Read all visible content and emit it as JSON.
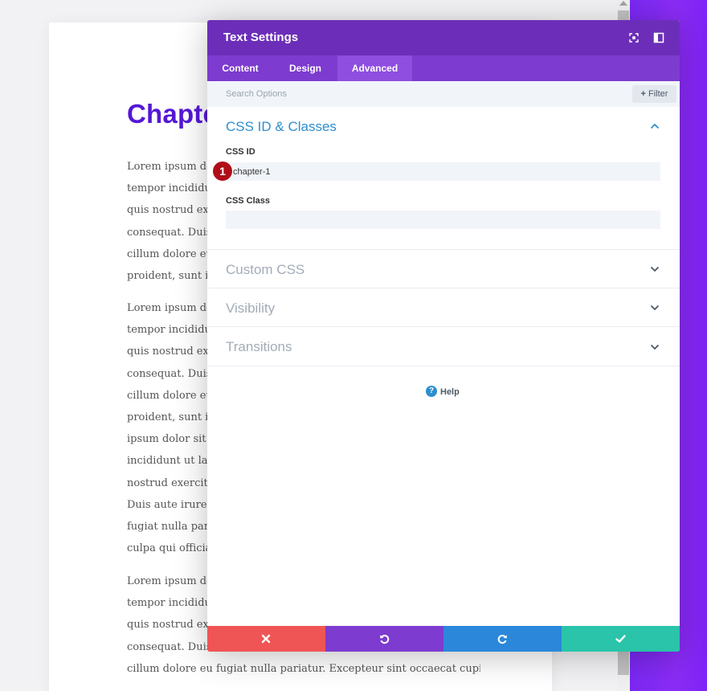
{
  "colors": {
    "header": "#6c2eb9",
    "tabs": "#7d3bcf",
    "tab_active": "#8f4ee0",
    "accent_blue": "#2e8ecf",
    "heading_purple": "#5418d6",
    "cancel": "#ef5555",
    "undo": "#7e3bd0",
    "redo": "#2b87da",
    "save": "#29c4a9"
  },
  "background_page": {
    "heading": "Chapte",
    "paragraphs": [
      [
        "Lorem ipsum dol",
        "tempor incididunt",
        "quis nostrud exe",
        "consequat. Duis",
        "cillum dolore eu f",
        "proident, sunt in c"
      ],
      [
        "Lorem ipsum dol",
        "tempor incididunt",
        "quis nostrud exe",
        "consequat. Duis",
        "cillum dolore eu f",
        "proident, sunt in c",
        "ipsum dolor sit a",
        "incididunt ut labo",
        "nostrud exercitati",
        "Duis aute irure do",
        "fugiat nulla pariat",
        "culpa qui officia de"
      ],
      [
        "Lorem ipsum dol",
        "tempor incididunt",
        "quis nostrud exe",
        "consequat. Duis",
        "cillum dolore eu fugiat nulla pariatur. Excepteur sint occaecat cupidatat non"
      ]
    ]
  },
  "modal": {
    "title": "Text Settings",
    "header_icons": [
      "fullscreen-icon",
      "sidebar-layout-icon"
    ],
    "tabs": [
      {
        "label": "Content",
        "active": false
      },
      {
        "label": "Design",
        "active": false
      },
      {
        "label": "Advanced",
        "active": true
      }
    ],
    "search": {
      "placeholder": "Search Options"
    },
    "filter": {
      "label": "Filter"
    },
    "sections": {
      "css_id_classes": {
        "title": "CSS ID & Classes",
        "open": true,
        "css_id_label": "CSS ID",
        "css_id_value": "chapter-1",
        "css_class_label": "CSS Class",
        "css_class_value": ""
      },
      "custom_css": {
        "title": "Custom CSS",
        "open": false
      },
      "visibility": {
        "title": "Visibility",
        "open": false
      },
      "transitions": {
        "title": "Transitions",
        "open": false
      }
    },
    "badge": "1",
    "help": {
      "icon": "?",
      "label": "Help"
    },
    "footer_icons": [
      "close-icon",
      "undo-icon",
      "redo-icon",
      "check-icon"
    ]
  }
}
